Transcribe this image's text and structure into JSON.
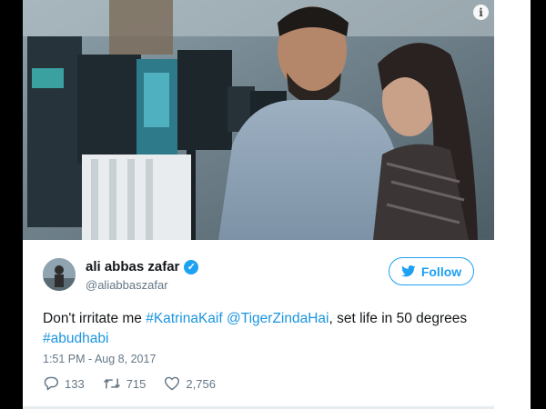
{
  "tweet": {
    "author_name": "ali abbas zafar",
    "author_handle": "@aliabbaszafar",
    "follow_label": "Follow",
    "text_parts": [
      {
        "text": "Don't irritate me ",
        "link": false
      },
      {
        "text": "#KatrinaKaif",
        "link": true
      },
      {
        "text": " ",
        "link": false
      },
      {
        "text": "@TigerZindaHai",
        "link": true
      },
      {
        "text": ", set life in 50 degrees ",
        "link": false
      },
      {
        "text": "#abudhabi",
        "link": true
      }
    ],
    "timestamp": "1:51 PM - Aug 8, 2017",
    "replies": "133",
    "retweets": "715",
    "likes": "2,756"
  },
  "icons": {
    "info": "info-icon",
    "verified": "verified-badge-icon",
    "follow_bird": "twitter-bird-icon",
    "reply": "reply-icon",
    "retweet": "retweet-icon",
    "like": "heart-icon"
  },
  "colors": {
    "twitter_blue": "#1da1f2",
    "link_blue": "#1b95e0",
    "muted_text": "#657786",
    "primary_text": "#14171a"
  }
}
